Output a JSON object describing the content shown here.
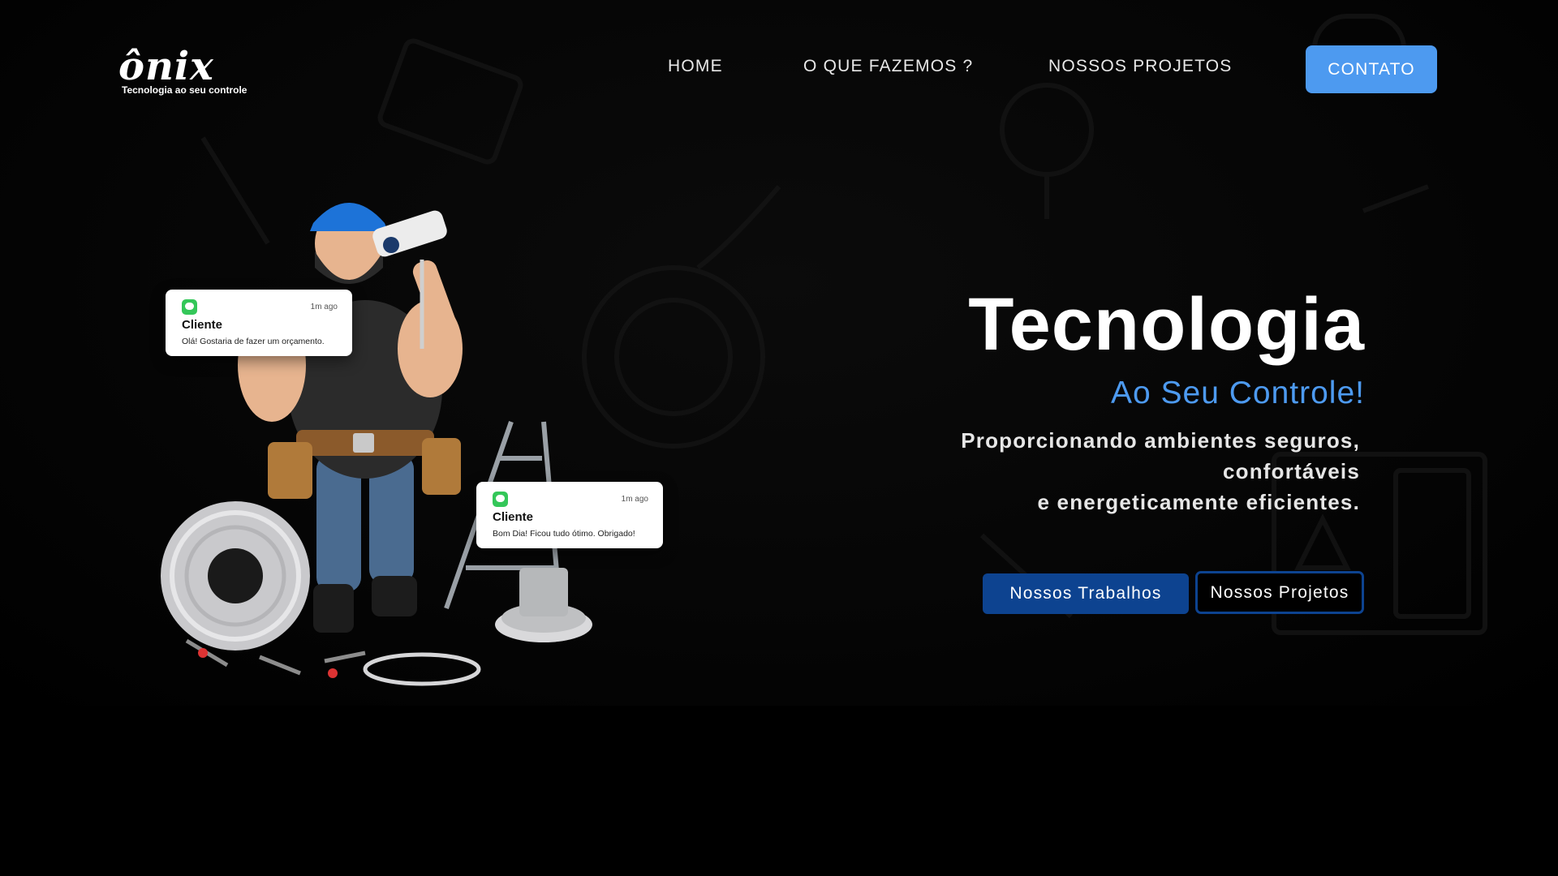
{
  "header": {
    "logo": {
      "word": "ônix",
      "tagline": "Tecnologia ao seu controle"
    },
    "nav": [
      {
        "label": "HOME"
      },
      {
        "label": "O QUE FAZEMOS ?"
      },
      {
        "label": "NOSSOS PROJETOS"
      }
    ],
    "contact_label": "CONTATO"
  },
  "hero": {
    "title": "Tecnologia",
    "subtitle": "Ao Seu Controle!",
    "description": {
      "line1": "Proporcionando ambientes seguros,",
      "line2": "confortáveis",
      "line3": "e energeticamente eficientes."
    },
    "primary_button": "Nossos Trabalhos",
    "secondary_button": "Nossos Projetos"
  },
  "notifications": [
    {
      "sender": "Cliente",
      "time": "1m ago",
      "message": "Olá! Gostaria de fazer um orçamento."
    },
    {
      "sender": "Cliente",
      "time": "1m ago",
      "message": "Bom Dia! Ficou tudo ótimo. Obrigado!"
    }
  ],
  "colors": {
    "background": "#000000",
    "accent": "#4d9af0",
    "button_primary": "#0d4390"
  },
  "illustration": {
    "icon": "electrician-technician-illustration"
  }
}
